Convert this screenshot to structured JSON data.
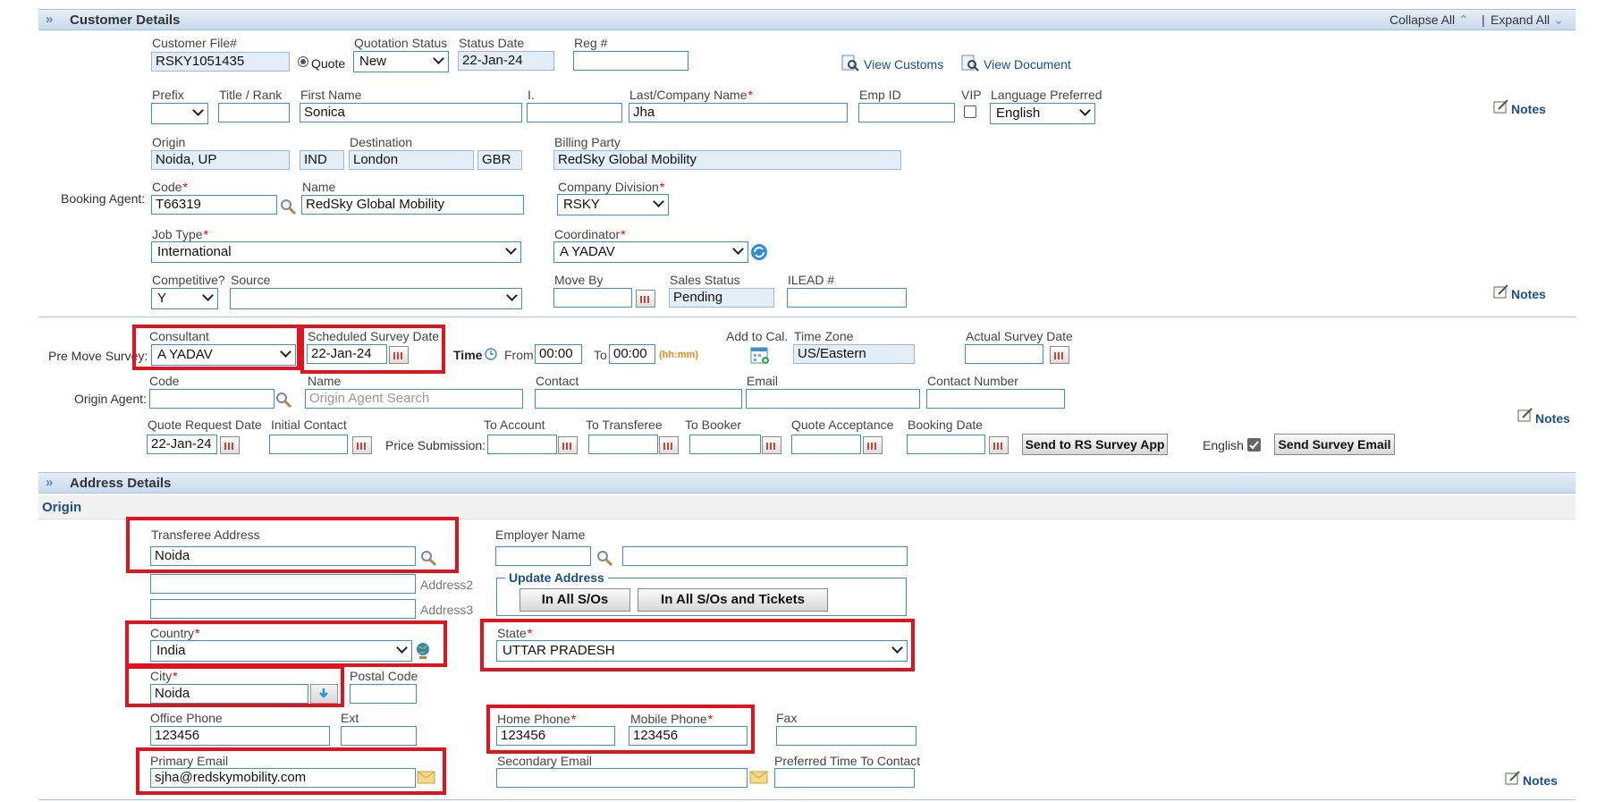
{
  "customer": {
    "section_title": "Customer Details",
    "collapse_all": "Collapse All",
    "expand_all": "Expand All",
    "separator": "|",
    "customer_file_label": "Customer File#",
    "customer_file": "RSKY1051435",
    "quote_label": "Quote",
    "quotation_status_label": "Quotation Status",
    "quotation_status": "New",
    "status_date_label": "Status Date",
    "status_date": "22-Jan-24",
    "reg_label": "Reg #",
    "reg": "",
    "view_customs": "View Customs",
    "view_document": "View Document",
    "prefix_label": "Prefix",
    "title_rank_label": "Title / Rank",
    "first_name_label": "First Name",
    "first_name": "Sonica",
    "initial_label": "I.",
    "last_name_label": "Last/Company Name",
    "last_name": "Jha",
    "emp_id_label": "Emp ID",
    "vip_label": "VIP",
    "language_label": "Language Preferred",
    "language": "English",
    "notes": "Notes",
    "origin_label": "Origin",
    "origin": "Noida, UP",
    "origin_country": "IND",
    "destination_label": "Destination",
    "destination": "London",
    "destination_country": "GBR",
    "billing_party_label": "Billing Party",
    "billing_party": "RedSky Global Mobility",
    "booking_agent_label": "Booking Agent:",
    "code_label": "Code",
    "code": "T66319",
    "name_label": "Name",
    "name": "RedSky Global Mobility",
    "company_division_label": "Company Division",
    "company_division": "RSKY",
    "job_type_label": "Job Type",
    "job_type": "International",
    "coordinator_label": "Coordinator",
    "coordinator": "A YADAV",
    "competitive_label": "Competitive?",
    "competitive": "Y",
    "source_label": "Source",
    "move_by_label": "Move By",
    "sales_status_label": "Sales Status",
    "sales_status": "Pending",
    "ilead_label": "ILEAD #"
  },
  "survey": {
    "pre_move_label": "Pre Move Survey:",
    "consultant_label": "Consultant",
    "consultant": "A YADAV",
    "scheduled_label": "Scheduled Survey Date",
    "scheduled_date": "22-Jan-24",
    "time_label": "Time",
    "from_label": "From",
    "from_time": "00:00",
    "to_label": "To",
    "to_time": "00:00",
    "hhmm": "(hh:mm)",
    "add_to_cal": "Add to Cal.",
    "time_zone_label": "Time Zone",
    "time_zone": "US/Eastern",
    "actual_survey_label": "Actual Survey Date",
    "origin_agent_label": "Origin Agent:",
    "code_label": "Code",
    "name_label": "Name",
    "name_placeholder": "Origin Agent Search",
    "contact_label": "Contact",
    "email_label": "Email",
    "contact_number_label": "Contact Number",
    "quote_request_label": "Quote Request Date",
    "quote_request_date": "22-Jan-24",
    "initial_contact_label": "Initial Contact",
    "price_submission_label": "Price Submission:",
    "to_account_label": "To Account",
    "to_transferee_label": "To Transferee",
    "to_booker_label": "To Booker",
    "quote_acceptance_label": "Quote Acceptance",
    "booking_date_label": "Booking Date",
    "send_rs_button": "Send to RS Survey App",
    "english_label": "English",
    "send_email_button": "Send Survey Email"
  },
  "address": {
    "section_title": "Address Details",
    "origin_title": "Origin",
    "transferee_address_label": "Transferee Address",
    "transferee_address": "Noida",
    "address2_label": "Address2",
    "address3_label": "Address3",
    "employer_name_label": "Employer Name",
    "update_address_label": "Update Address",
    "in_all_sos": "In All S/Os",
    "in_all_sos_tickets": "In All S/Os and Tickets",
    "country_label": "Country",
    "country": "India",
    "state_label": "State",
    "state": "UTTAR PRADESH",
    "city_label": "City",
    "city": "Noida",
    "postal_code_label": "Postal Code",
    "office_phone_label": "Office Phone",
    "office_phone": "123456",
    "ext_label": "Ext",
    "home_phone_label": "Home Phone",
    "home_phone": "123456",
    "mobile_phone_label": "Mobile Phone",
    "mobile_phone": "123456",
    "fax_label": "Fax",
    "primary_email_label": "Primary Email",
    "primary_email": "sjha@redskymobility.com",
    "secondary_email_label": "Secondary Email",
    "preferred_time_label": "Preferred Time To Contact",
    "required_mark": "*"
  },
  "colors": {
    "accent": "#3d8fd0",
    "highlight": "#e0141e",
    "header": "#c8daec"
  }
}
